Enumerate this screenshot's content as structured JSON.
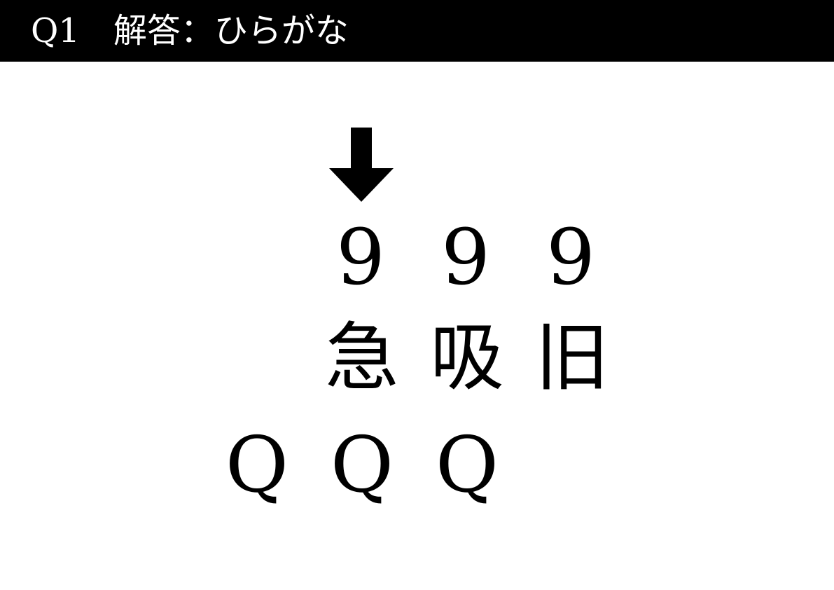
{
  "header": {
    "title": "Q1　解答：ひらがな",
    "background": "#000000",
    "text_color": "#ffffff"
  },
  "marker": {
    "icon": "down-arrow-icon",
    "color": "#000000"
  },
  "puzzle": {
    "digits": [
      "9",
      "9",
      "9"
    ],
    "kanji": [
      "急",
      "吸",
      "旧"
    ],
    "letters": [
      "Q",
      "Q",
      "Q"
    ]
  }
}
